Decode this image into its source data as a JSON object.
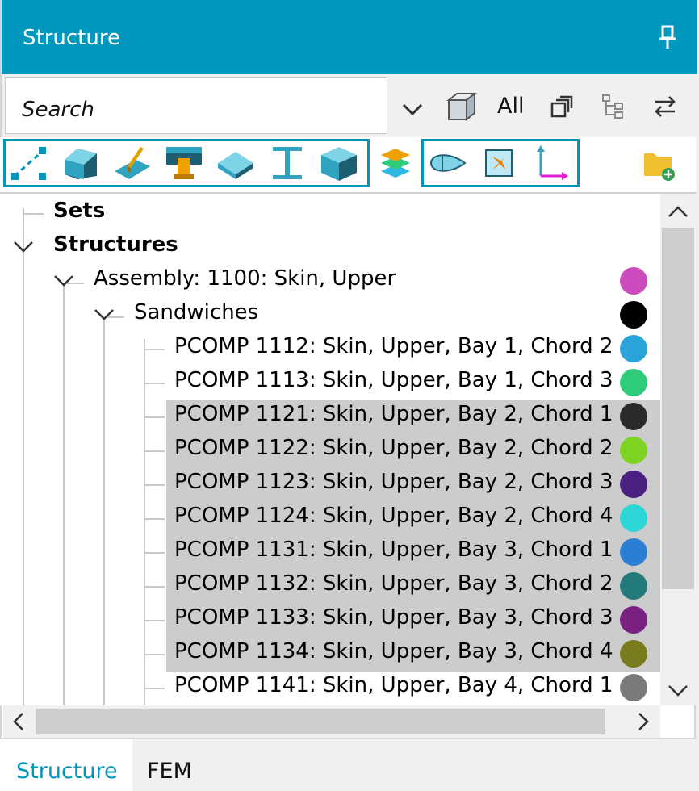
{
  "panel": {
    "title": "Structure"
  },
  "search": {
    "placeholder": "Search",
    "scope_label": "All"
  },
  "tree": {
    "sets": "Sets",
    "structures": "Structures",
    "assembly": {
      "label": "Assembly: 1100: Skin, Upper",
      "color": "#cc4cbf"
    },
    "sandwiches": {
      "label": "Sandwiches",
      "color": "#000000"
    },
    "items": [
      {
        "label": "PCOMP 1112: Skin, Upper, Bay 1, Chord 2",
        "color": "#2aa3d8",
        "selected": false
      },
      {
        "label": "PCOMP 1113: Skin, Upper, Bay 1, Chord 3",
        "color": "#2ecc7a",
        "selected": false
      },
      {
        "label": "PCOMP 1121: Skin, Upper, Bay 2, Chord 1",
        "color": "#2a2a2a",
        "selected": true
      },
      {
        "label": "PCOMP 1122: Skin, Upper, Bay 2, Chord 2",
        "color": "#7ed321",
        "selected": true
      },
      {
        "label": "PCOMP 1123: Skin, Upper, Bay 2, Chord 3",
        "color": "#4a2180",
        "selected": true
      },
      {
        "label": "PCOMP 1124: Skin, Upper, Bay 2, Chord 4",
        "color": "#2dd6d6",
        "selected": true
      },
      {
        "label": "PCOMP 1131: Skin, Upper, Bay 3, Chord 1",
        "color": "#2a7fd4",
        "selected": true
      },
      {
        "label": "PCOMP 1132: Skin, Upper, Bay 3, Chord 2",
        "color": "#237a7a",
        "selected": true
      },
      {
        "label": "PCOMP 1133: Skin, Upper, Bay 3, Chord 3",
        "color": "#7a2080",
        "selected": true
      },
      {
        "label": "PCOMP 1134: Skin, Upper, Bay 3, Chord 4",
        "color": "#7a7a1e",
        "selected": true
      },
      {
        "label": "PCOMP 1141: Skin, Upper, Bay 4, Chord 1",
        "color": "#7a7a7a",
        "selected": false
      }
    ]
  },
  "tabs": [
    {
      "label": "Structure",
      "active": true
    },
    {
      "label": "FEM",
      "active": false
    }
  ],
  "colors": {
    "accent": "#0097bf",
    "selection": "#cccccc"
  },
  "icons": [
    "pin-icon",
    "chevron-down-icon",
    "cube-filter-icon",
    "collapse-all-icon",
    "hierarchy-icon",
    "swap-icon",
    "nodes-icon",
    "solid-icon",
    "stiffener-icon",
    "joint-icon",
    "plate-icon",
    "beam-icon",
    "box-icon",
    "layers-icon",
    "airfoil-icon",
    "region-icon",
    "coordinate-system-icon",
    "new-folder-icon"
  ]
}
